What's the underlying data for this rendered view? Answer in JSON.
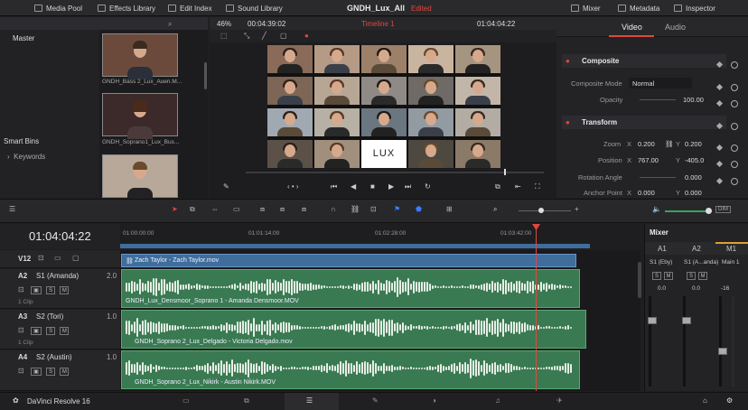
{
  "topbar": {
    "media_pool": "Media Pool",
    "effects_library": "Effects Library",
    "edit_index": "Edit Index",
    "sound_library": "Sound Library",
    "project_name": "GNDH_Lux_All",
    "edited_badge": "Edited",
    "mixer": "Mixer",
    "metadata": "Metadata",
    "inspector": "Inspector"
  },
  "media_pool": {
    "bin_master": "Master",
    "smart_bins": "Smart Bins",
    "keywords": "Keywords",
    "clips": [
      {
        "name": "GNDH_Bass 2_Lux_Auen.M..."
      },
      {
        "name": "GNDH_Soprano1_Lux_Bus..."
      },
      {
        "name": ""
      }
    ]
  },
  "viewer": {
    "zoom": "46%",
    "source_timecode": "00:04:39:02",
    "timeline_name": "Timeline 1",
    "record_timecode": "01:04:04:22",
    "lux_label": "LUX"
  },
  "inspector": {
    "tab_video": "Video",
    "tab_audio": "Audio",
    "composite_header": "Composite",
    "composite_mode_label": "Composite Mode",
    "composite_mode_value": "Normal",
    "opacity_label": "Opacity",
    "opacity_value": "100.00",
    "transform_header": "Transform",
    "zoom_label": "Zoom",
    "zoom_x_axis": "X",
    "zoom_x": "0.200",
    "zoom_y_axis": "Y",
    "zoom_y": "0.200",
    "position_label": "Position",
    "position_x_axis": "X",
    "position_x": "767.00",
    "position_y_axis": "Y",
    "position_y": "-405.0",
    "rotation_label": "Rotation Angle",
    "rotation_value": "0.000",
    "anchor_label": "Anchor Point",
    "anchor_x_axis": "X",
    "anchor_x": "0.000",
    "anchor_y_axis": "Y",
    "anchor_y": "0.000"
  },
  "timeline": {
    "timecode": "01:04:04:22",
    "ruler": [
      "01:00:00:00",
      "01:01:14:00",
      "01:02:28:00",
      "01:03:42:00"
    ],
    "dim_label": "DIM",
    "tracks": [
      {
        "id": "V12",
        "name": "",
        "clip": "Zach Taylor - Zach Taylor.mov",
        "gain": "",
        "clips_count": ""
      },
      {
        "id": "A2",
        "name": "S1 (Amanda)",
        "clip": "GNDH_Lux_Densmoor_Soprano 1 - Amanda Densmoor.MOV",
        "gain": "2.0",
        "clips_count": "1 Clip"
      },
      {
        "id": "A3",
        "name": "S2 (Tori)",
        "clip": "GNDH_Soprano 2_Lux_Delgado - Victoria Delgado.mov",
        "gain": "1.0",
        "clips_count": "1 Clip"
      },
      {
        "id": "A4",
        "name": "S2 (Austin)",
        "clip": "GNDH_Soprano 2_Lux_Nikirk - Austin Nikirk.MOV",
        "gain": "1.0",
        "clips_count": ""
      }
    ],
    "btn_s": "S",
    "btn_m": "M"
  },
  "mixer": {
    "title": "Mixer",
    "channels": [
      "A1",
      "A2",
      "M1"
    ],
    "channel_names": [
      "S1 (Eby)",
      "S1 (A...anda)",
      "Main 1"
    ],
    "values": [
      "0.0",
      "0.0",
      "-16"
    ],
    "btn_s": "S",
    "btn_m": "M"
  },
  "footer": {
    "app_name": "DaVinci Resolve 16"
  },
  "colors": {
    "accent_red": "#e0473f",
    "clip_green": "#3a7a52",
    "clip_blue": "#3f6d9c",
    "playhead": "#e0473f"
  }
}
